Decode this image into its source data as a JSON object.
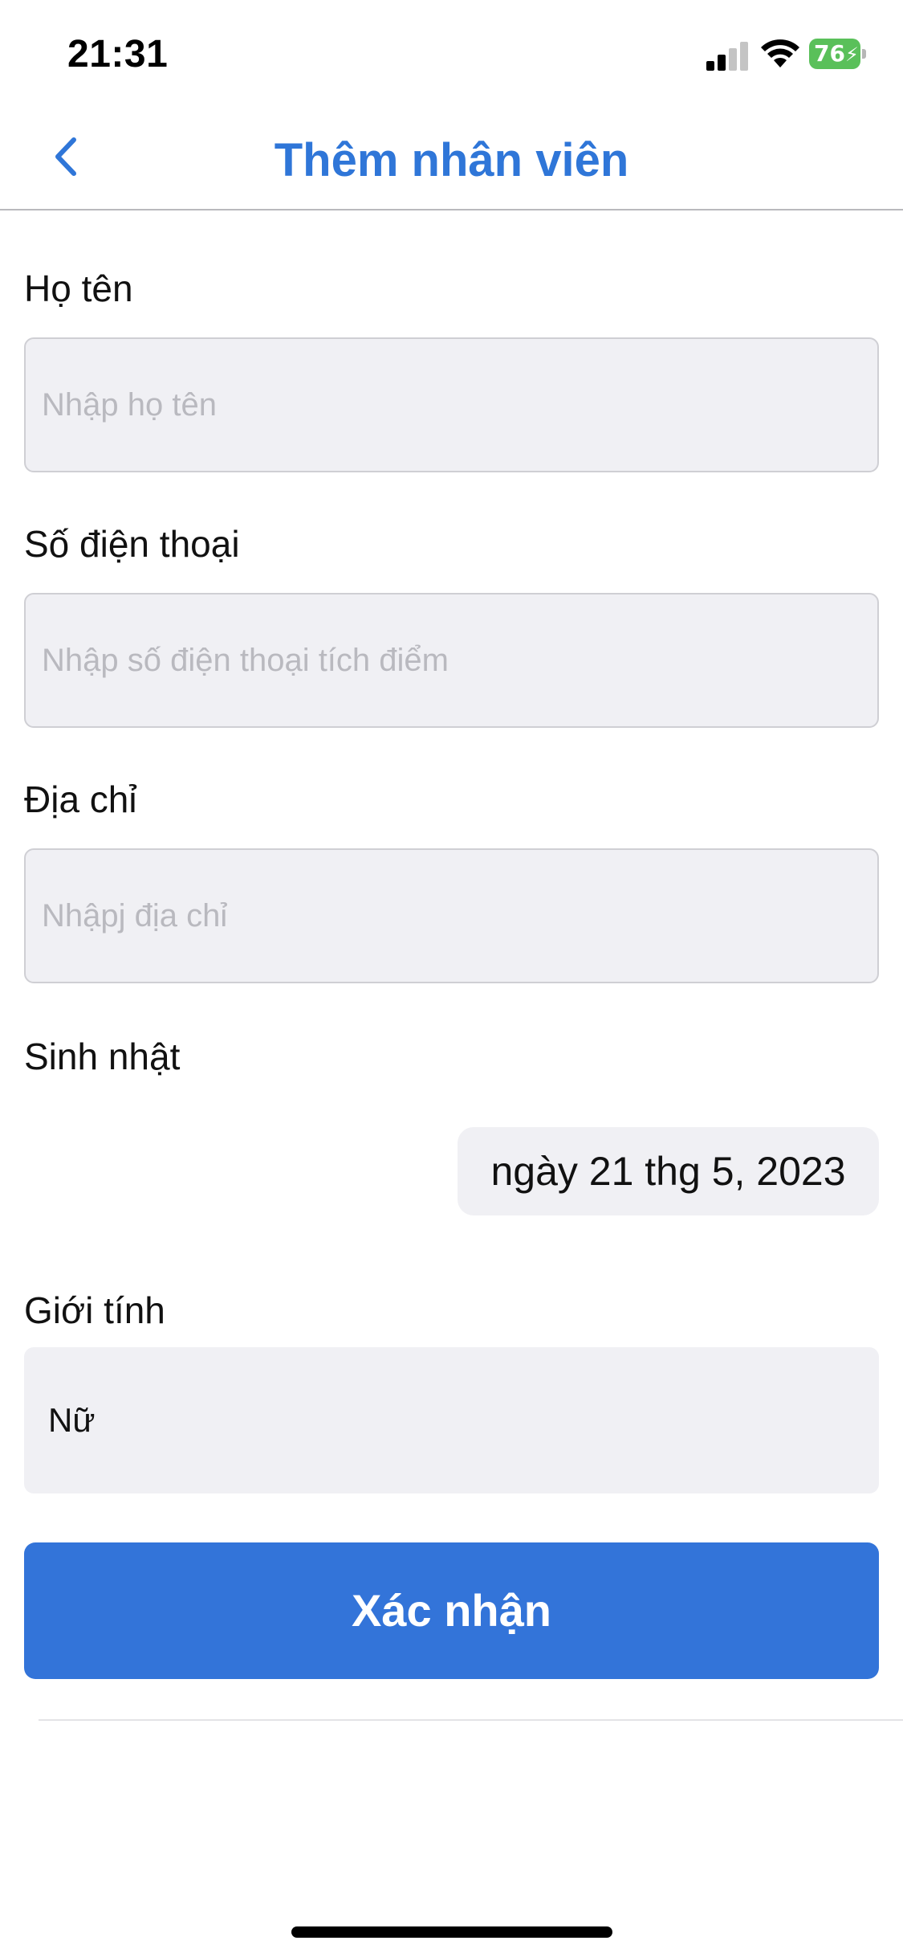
{
  "status_bar": {
    "time": "21:31",
    "battery_percent": "76",
    "signal_icon": "cellular-signal-icon",
    "wifi_icon": "wifi-icon",
    "battery_icon": "battery-charging-icon",
    "battery_color": "#5ac05a"
  },
  "nav": {
    "back_icon": "chevron-left-icon",
    "title": "Thêm nhân viên",
    "accent_color": "#2f76d8"
  },
  "form": {
    "name": {
      "label": "Họ tên",
      "placeholder": "Nhập họ tên",
      "value": ""
    },
    "phone": {
      "label": "Số điện thoại",
      "placeholder": "Nhập số điện thoại tích điểm",
      "value": ""
    },
    "address": {
      "label": "Địa chỉ",
      "placeholder": "Nhậpj địa chỉ",
      "value": ""
    },
    "birthday": {
      "label": "Sinh nhật",
      "value": "ngày 21 thg 5, 2023"
    },
    "gender": {
      "label": "Giới tính",
      "value": "Nữ"
    }
  },
  "actions": {
    "confirm_label": "Xác nhận",
    "confirm_color": "#3374d9"
  }
}
